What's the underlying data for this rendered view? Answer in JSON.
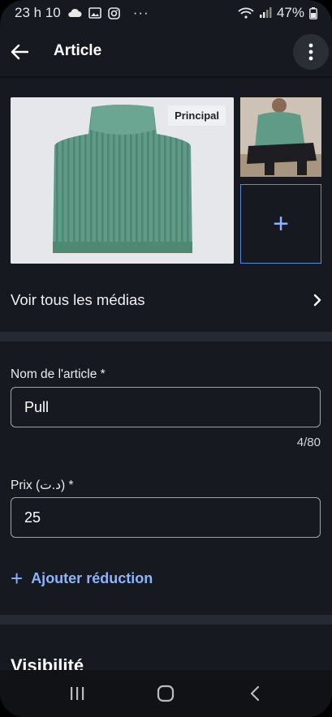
{
  "status_bar": {
    "time": "23 h 10",
    "icons": [
      "cloud-icon",
      "image-icon",
      "instagram-icon",
      "more-dots-icon"
    ],
    "battery_percent": "47%",
    "right_icons": [
      "wifi-icon",
      "signal-icon",
      "battery-icon"
    ]
  },
  "header": {
    "title": "Article",
    "back_icon": "arrow-left-icon",
    "menu_icon": "more-vertical-icon"
  },
  "media": {
    "main_badge": "Principal",
    "add_label": "+",
    "see_all_label": "Voir tous les médias"
  },
  "form": {
    "name_label": "Nom de l'article *",
    "name_value": "Pull",
    "name_counter": "4/80",
    "price_label": "Prix (د.ت) *",
    "price_value": "25",
    "add_discount_label": "Ajouter réduction",
    "add_discount_icon": "+"
  },
  "sections": {
    "visibility_title": "Visibilité"
  },
  "colors": {
    "background": "#16191f",
    "accent": "#8cb4ff",
    "separator": "#262b33"
  }
}
